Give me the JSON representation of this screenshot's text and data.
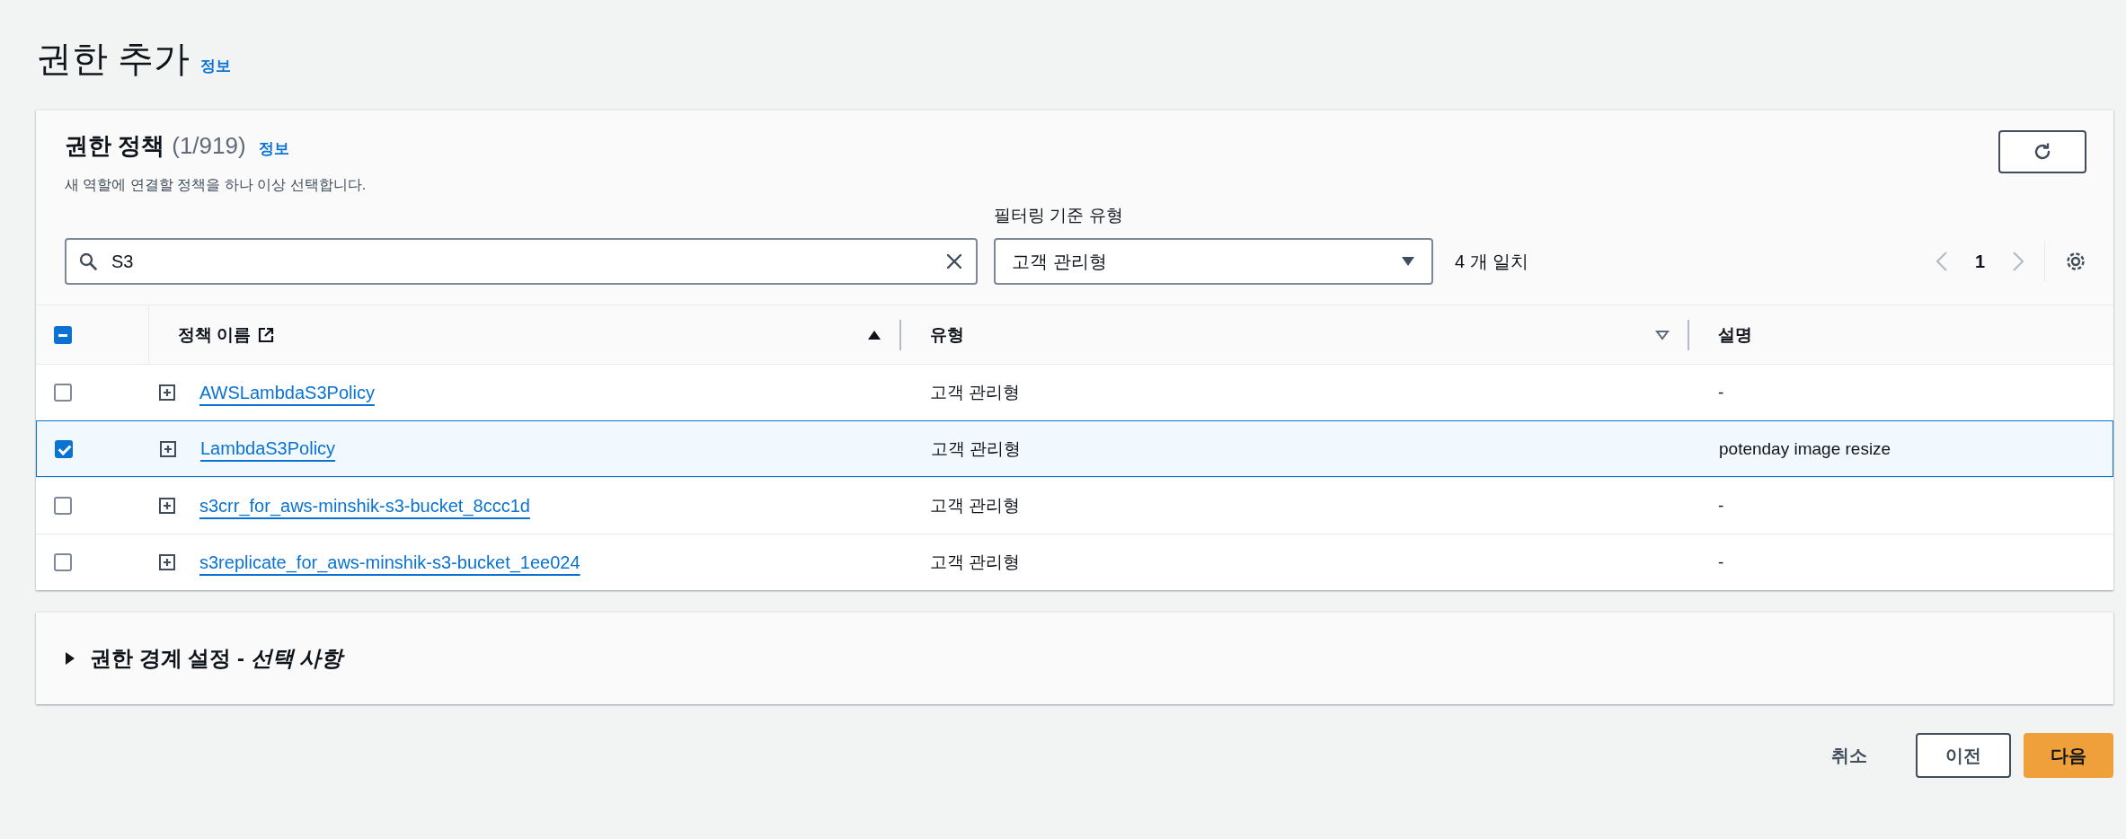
{
  "page": {
    "title": "권한 추가",
    "info_link": "정보"
  },
  "policies_panel": {
    "heading": "권한 정책",
    "count": "(1/919)",
    "info_link": "정보",
    "description": "새 역할에 연결할 정책을 하나 이상 선택합니다.",
    "search": {
      "value": "S3"
    },
    "filter": {
      "label": "필터링 기준 유형",
      "value": "고객 관리형"
    },
    "match_count": "4 개 일치",
    "pagination": {
      "current_page": "1"
    },
    "table": {
      "select_all": {
        "indeterminate": true
      },
      "columns": [
        {
          "label": "정책 이름",
          "sortable": true,
          "sorted": true,
          "external_link": true
        },
        {
          "label": "유형",
          "sortable": true,
          "sorted": false
        },
        {
          "label": "설명"
        }
      ],
      "rows": [
        {
          "selected": false,
          "name": "AWSLambdaS3Policy",
          "type": "고객 관리형",
          "description": "-"
        },
        {
          "selected": true,
          "name": "LambdaS3Policy",
          "type": "고객 관리형",
          "description": "potenday image resize"
        },
        {
          "selected": false,
          "name": "s3crr_for_aws-minshik-s3-bucket_8ccc1d",
          "type": "고객 관리형",
          "description": "-"
        },
        {
          "selected": false,
          "name": "s3replicate_for_aws-minshik-s3-bucket_1ee024",
          "type": "고객 관리형",
          "description": "-"
        }
      ]
    }
  },
  "boundary_panel": {
    "expanded": false,
    "title": "권한 경계 설정 - ",
    "title_optional": "선택 사항"
  },
  "footer_buttons": [
    {
      "kind": "link",
      "label": "취소"
    },
    {
      "kind": "normal",
      "label": "이전"
    },
    {
      "kind": "primary",
      "label": "다음"
    }
  ]
}
